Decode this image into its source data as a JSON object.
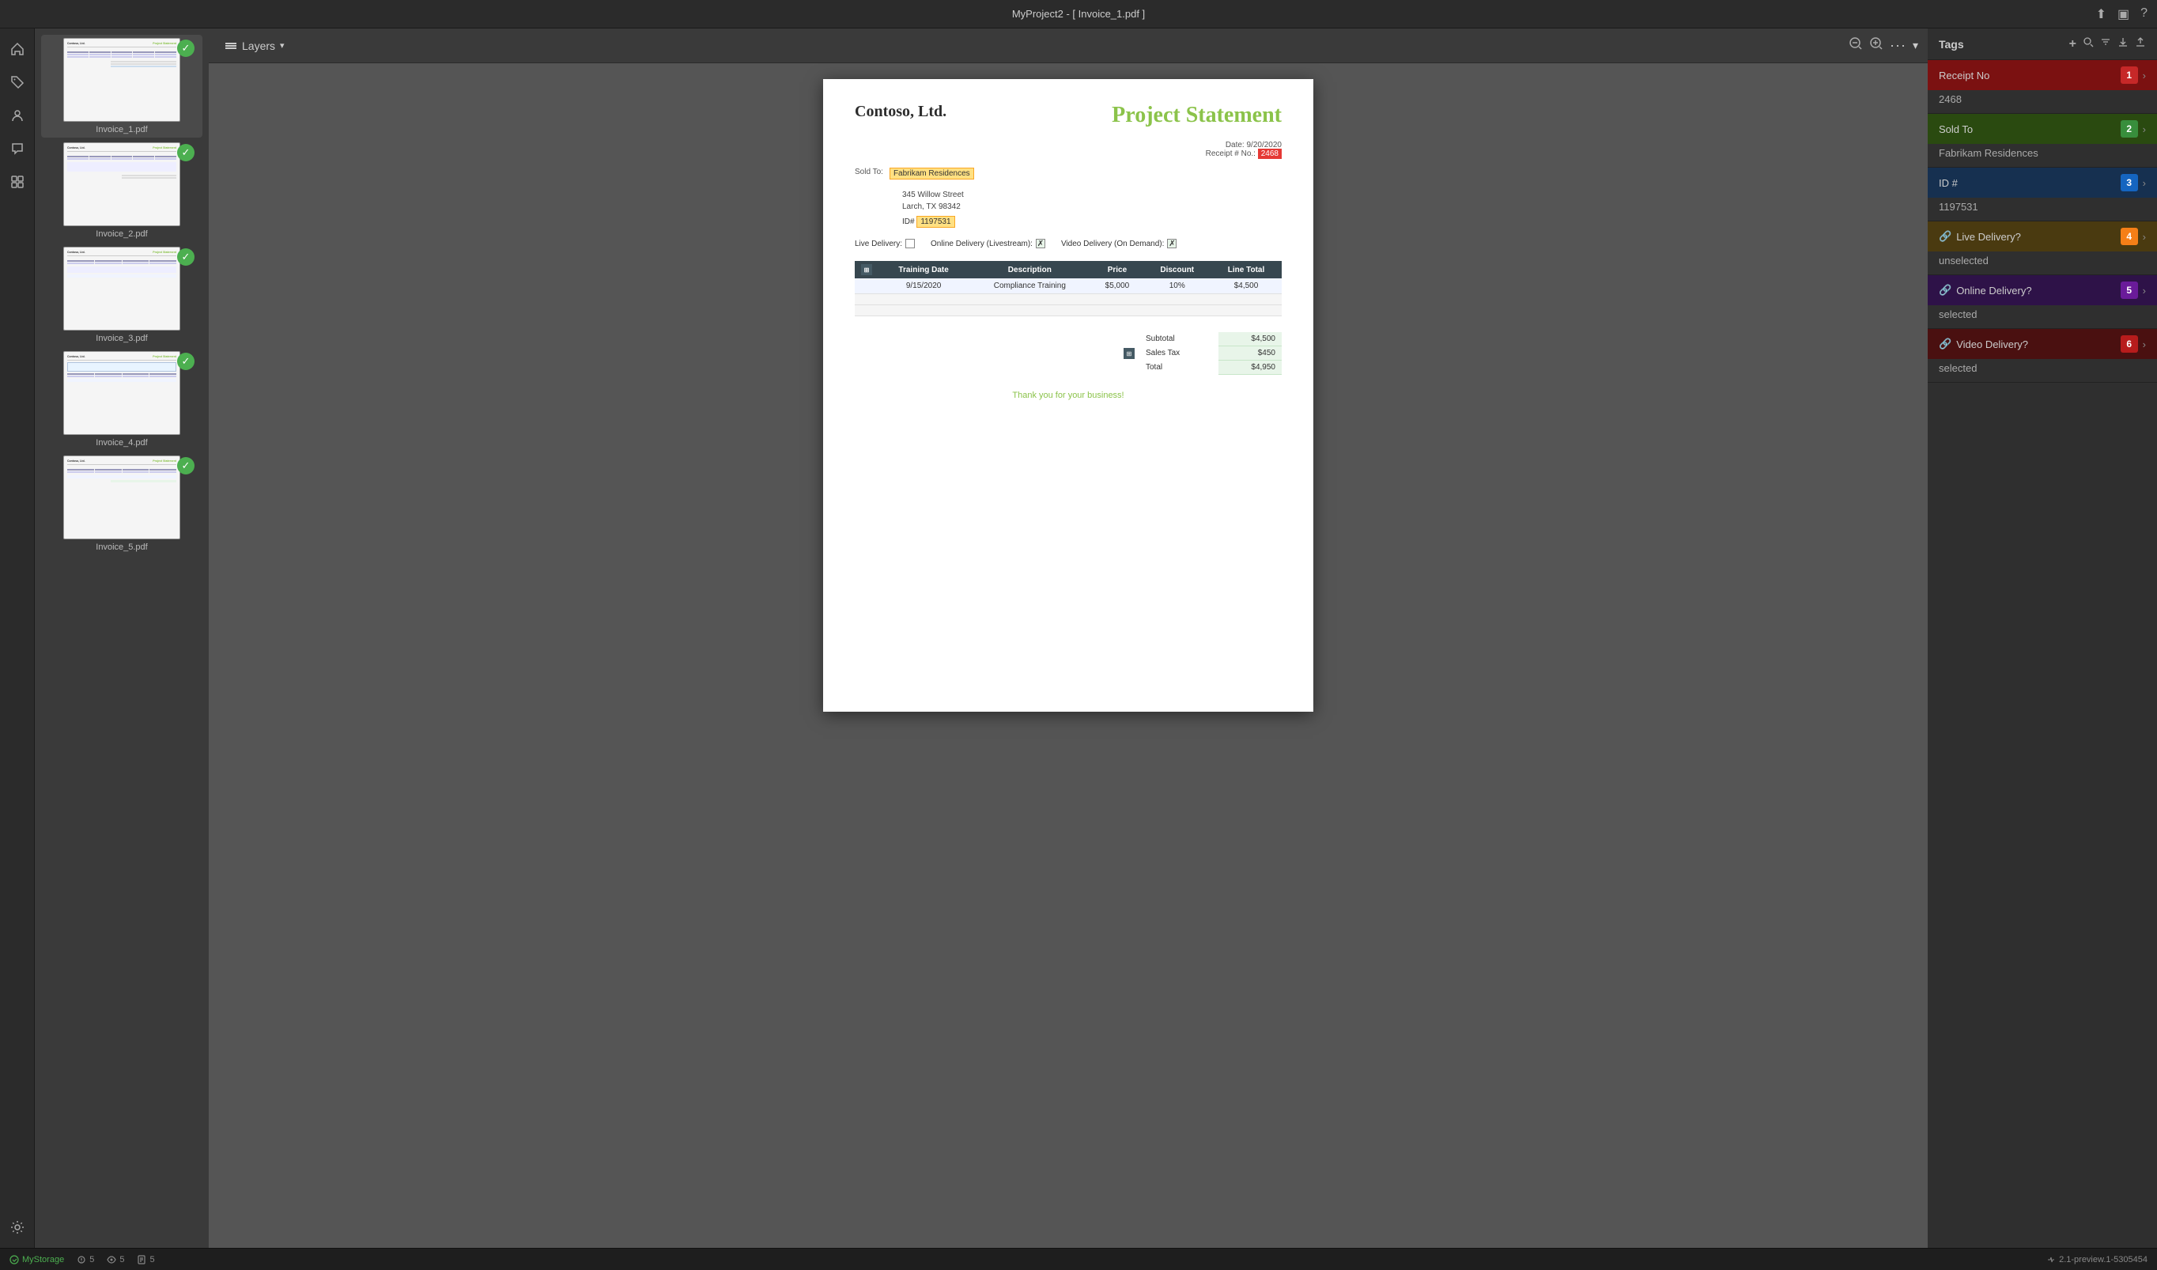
{
  "titlebar": {
    "title": "MyProject2 - [ Invoice_1.pdf ]",
    "share_icon": "⬆",
    "panel_icon": "▣",
    "help_icon": "?"
  },
  "toolbar": {
    "layers_label": "Layers",
    "zoom_out_icon": "🔍",
    "zoom_in_icon": "🔍",
    "more_icon": "···",
    "chevron_down": "▾"
  },
  "thumbnails": [
    {
      "name": "Invoice_1.pdf",
      "active": true,
      "checked": true
    },
    {
      "name": "Invoice_2.pdf",
      "active": false,
      "checked": true
    },
    {
      "name": "Invoice_3.pdf",
      "active": false,
      "checked": true
    },
    {
      "name": "Invoice_4.pdf",
      "active": false,
      "checked": true
    },
    {
      "name": "Invoice_5.pdf",
      "active": false,
      "checked": true
    }
  ],
  "document": {
    "company": "Contoso, Ltd.",
    "title": "Project Statement",
    "date_label": "Date:",
    "date_value": "9/20/2020",
    "receipt_label": "Receipt # No.:",
    "receipt_highlight": "2468",
    "sold_to_label": "Sold To:",
    "sold_to_value": "Fabrikam Residences",
    "address_line1": "345 Willow Street",
    "address_line2": "Larch, TX  98342",
    "id_label": "ID#",
    "id_value": "1197531",
    "live_delivery_label": "Live Delivery:",
    "live_checked": false,
    "online_delivery_label": "Online Delivery (Livestream):",
    "online_checked": true,
    "video_delivery_label": "Video Delivery (On Demand):",
    "video_checked": true,
    "table_headers": [
      "Training Date",
      "Description",
      "Price",
      "Discount",
      "Line Total"
    ],
    "table_rows": [
      {
        "date": "9/15/2020",
        "description": "Compliance Training",
        "price": "$5,000",
        "discount": "10%",
        "total": "$4,500"
      }
    ],
    "subtotal_label": "Subtotal",
    "subtotal_value": "$4,500",
    "tax_label": "Sales Tax",
    "tax_value": "$450",
    "total_label": "Total",
    "total_value": "$4,950",
    "footer": "Thank you for your business!"
  },
  "tags": {
    "title": "Tags",
    "items": [
      {
        "id": 1,
        "name": "Receipt No",
        "value": "2468",
        "color_class": "receipt",
        "badge_bg": "#c62828",
        "has_link": false
      },
      {
        "id": 2,
        "name": "Sold To",
        "value": "Fabrikam Residences",
        "color_class": "soldto",
        "badge_bg": "#388e3c",
        "has_link": false
      },
      {
        "id": 3,
        "name": "ID #",
        "value": "1197531",
        "color_class": "id-hash",
        "badge_bg": "#1565c0",
        "has_link": false
      },
      {
        "id": 4,
        "name": "Live Delivery?",
        "value": "unselected",
        "color_class": "livedelivery",
        "badge_bg": "#f57f17",
        "has_link": true
      },
      {
        "id": 5,
        "name": "Online Delivery?",
        "value": "selected",
        "color_class": "onlinedelivery",
        "badge_bg": "#6a1b9a",
        "has_link": true
      },
      {
        "id": 6,
        "name": "Video Delivery?",
        "value": "selected",
        "color_class": "videodelivery",
        "badge_bg": "#b71c1c",
        "has_link": true
      }
    ]
  },
  "status_bar": {
    "storage_label": "MyStorage",
    "annotations_count": "5",
    "views_count": "5",
    "files_count": "5",
    "version": "2.1-preview.1-5305454"
  },
  "sidebar": {
    "items": [
      {
        "icon": "🏠",
        "name": "home"
      },
      {
        "icon": "🏷",
        "name": "tags"
      },
      {
        "icon": "👤",
        "name": "users"
      },
      {
        "icon": "📌",
        "name": "pins"
      },
      {
        "icon": "🔌",
        "name": "plugins"
      }
    ]
  }
}
